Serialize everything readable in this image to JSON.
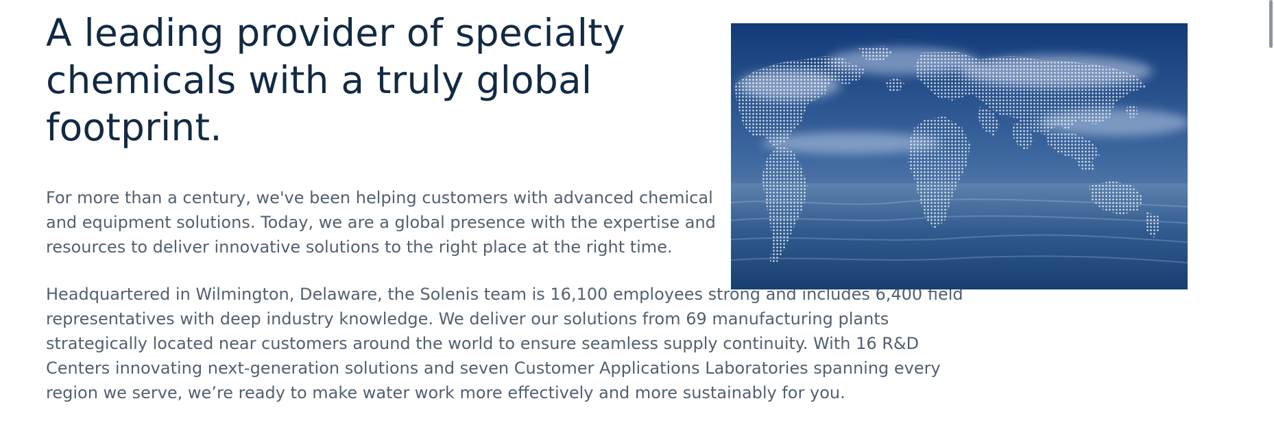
{
  "headline": "A leading provider of specialty chemicals with a truly global footprint.",
  "intro_paragraph": "For more than a century, we've been helping customers with advanced chemical and equipment solutions. Today, we are a global presence with the expertise and resources to deliver innovative solutions to the right place at the right time.",
  "details_paragraph": "Headquartered in Wilmington, Delaware, the Solenis team is 16,100 employees strong and includes 6,400 field representatives with deep industry knowledge. We deliver our solutions from 69 manufacturing plants strategically located near customers around the world to ensure seamless supply continuity. With 16 R&D Centers innovating next-generation solutions and seven Customer Applications Laboratories spanning every region we serve, we’re ready to make water work more effectively and more sustainably for you.",
  "image": {
    "icon": "world-map-over-ocean-image",
    "colors": {
      "sky_top": "#123a78",
      "sky_bottom": "#8ea6c6",
      "ocean_top": "#315b8f",
      "ocean_bottom": "#173e70",
      "map_dots": "#f3f6fa"
    }
  },
  "scrollbar": {
    "icon": "vertical-scrollbar"
  }
}
